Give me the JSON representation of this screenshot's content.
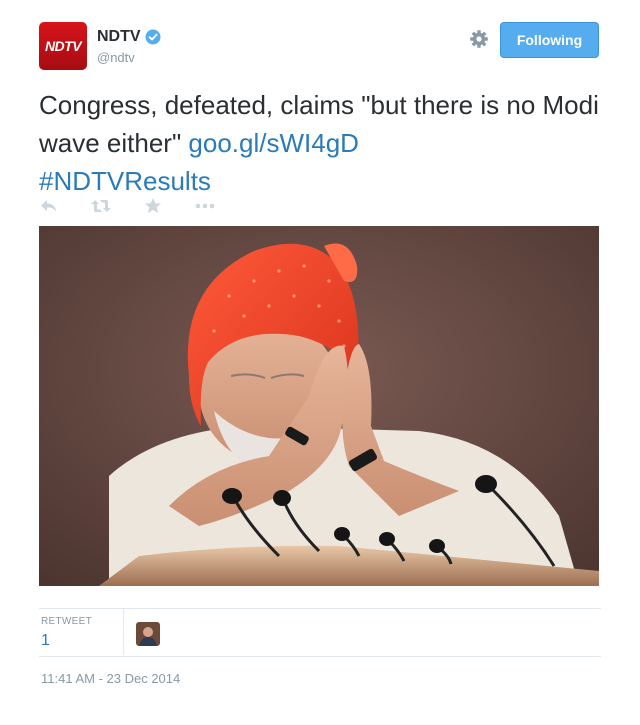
{
  "account": {
    "avatar_text": "NDTV",
    "display_name": "NDTV",
    "handle": "@ndtv",
    "verified_color": "#55acee"
  },
  "header": {
    "follow_label": "Following"
  },
  "tweet": {
    "text": "Congress, defeated, claims \"but there is no Modi wave either\" ",
    "link": "goo.gl/sWI4gD",
    "hashtag": "#NDTVResults"
  },
  "actions": {
    "icons": [
      "reply-icon",
      "retweet-icon",
      "favorite-icon",
      "more-icon"
    ]
  },
  "stats": {
    "retweet_label": "RETWEET",
    "retweet_count": "1"
  },
  "timestamp": "11:41 AM - 23 Dec 2014",
  "colors": {
    "accent": "#55acee",
    "link": "#2b7bb9",
    "brand_red": "#d8141b"
  }
}
